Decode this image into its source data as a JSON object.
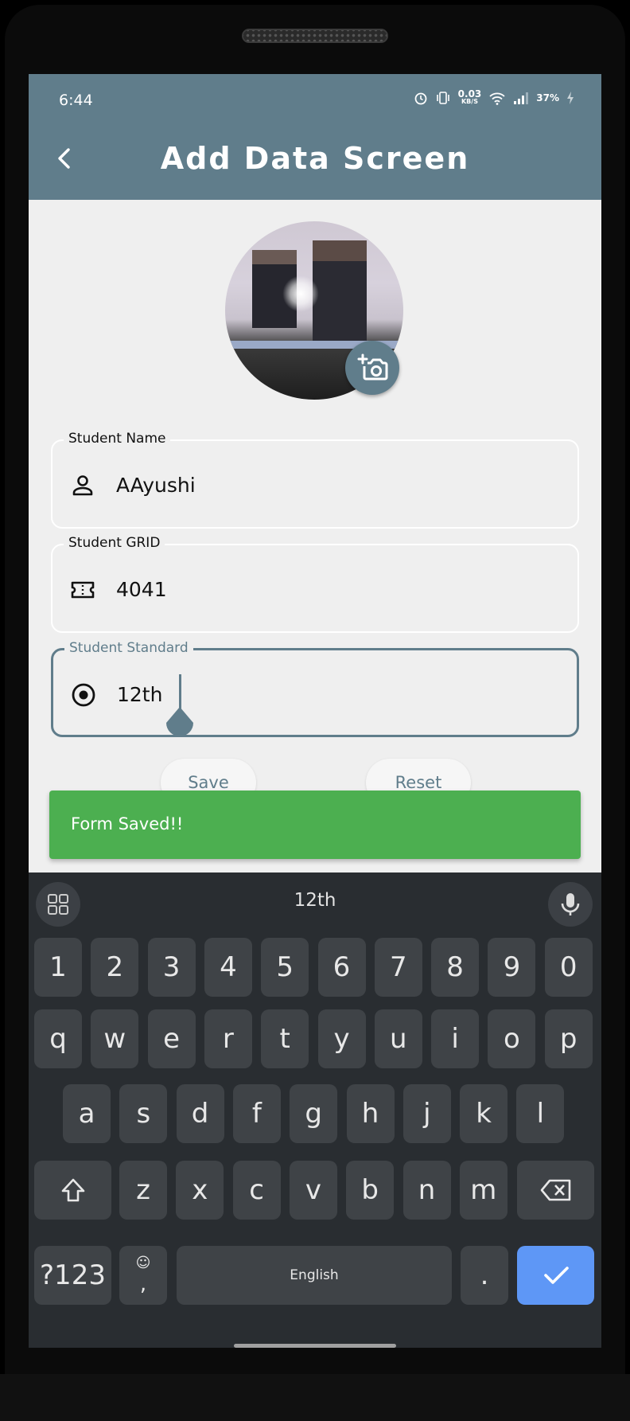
{
  "status": {
    "time": "6:44",
    "net_speed": "0.03",
    "net_unit": "KB/S",
    "battery": "37%"
  },
  "appbar": {
    "title": "Add Data Screen"
  },
  "form": {
    "name_label": "Student Name",
    "name_value": "AAyushi",
    "grid_label": "Student GRID",
    "grid_value": "4041",
    "standard_label": "Student Standard",
    "standard_value": "12th"
  },
  "buttons": {
    "save": "Save",
    "reset": "Reset"
  },
  "snackbar": {
    "message": "Form Saved!!"
  },
  "keyboard": {
    "suggestion": "12th",
    "number_row": [
      "1",
      "2",
      "3",
      "4",
      "5",
      "6",
      "7",
      "8",
      "9",
      "0"
    ],
    "row1": [
      "q",
      "w",
      "e",
      "r",
      "t",
      "y",
      "u",
      "i",
      "o",
      "p"
    ],
    "row2": [
      "a",
      "s",
      "d",
      "f",
      "g",
      "h",
      "j",
      "k",
      "l"
    ],
    "row3": [
      "z",
      "x",
      "c",
      "v",
      "b",
      "n",
      "m"
    ],
    "symbols_label": "?123",
    "comma": ",",
    "space_label": "English",
    "period": "."
  },
  "colors": {
    "primary": "#607d8b",
    "success": "#4caf50",
    "keyboard_bg": "#292d31",
    "enter_key": "#5e97f6"
  }
}
